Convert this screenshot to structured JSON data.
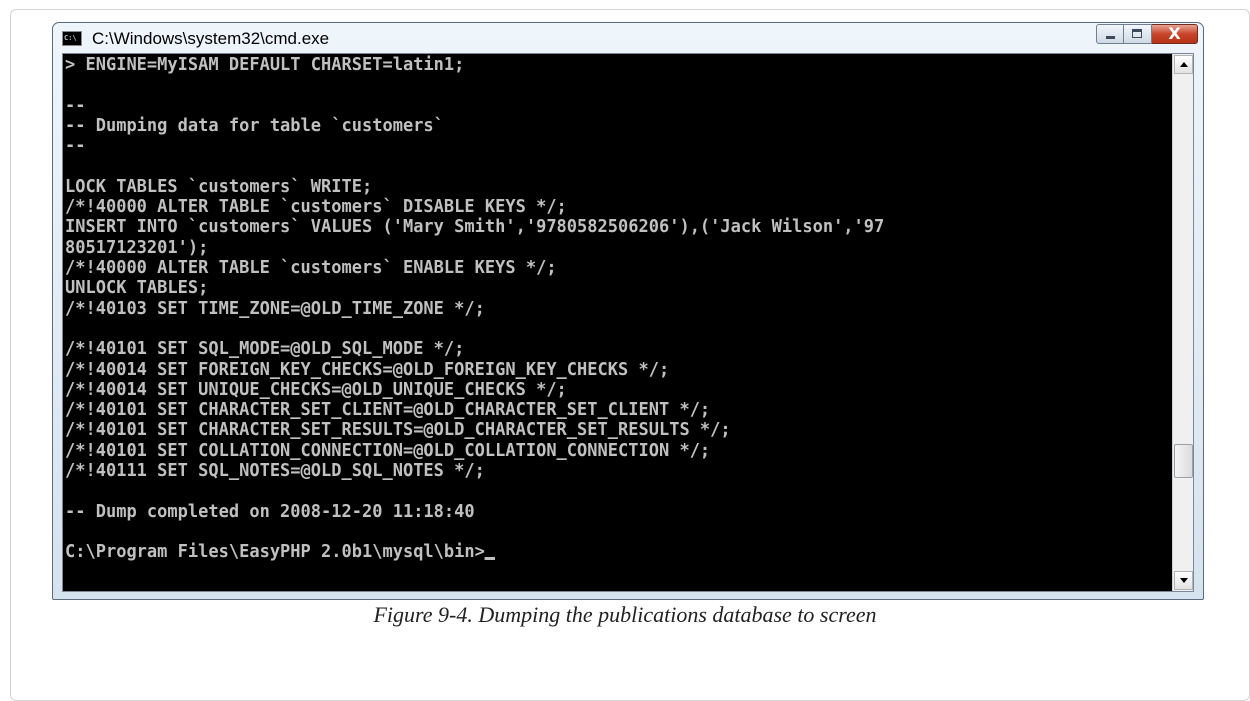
{
  "window": {
    "title": "C:\\Windows\\system32\\cmd.exe",
    "app_icon_text": "C:\\",
    "buttons": {
      "close": "X"
    }
  },
  "console": {
    "lines": [
      "> ENGINE=MyISAM DEFAULT CHARSET=latin1;",
      "",
      "--",
      "-- Dumping data for table `customers`",
      "--",
      "",
      "LOCK TABLES `customers` WRITE;",
      "/*!40000 ALTER TABLE `customers` DISABLE KEYS */;",
      "INSERT INTO `customers` VALUES ('Mary Smith','9780582506206'),('Jack Wilson','97",
      "80517123201');",
      "/*!40000 ALTER TABLE `customers` ENABLE KEYS */;",
      "UNLOCK TABLES;",
      "/*!40103 SET TIME_ZONE=@OLD_TIME_ZONE */;",
      "",
      "/*!40101 SET SQL_MODE=@OLD_SQL_MODE */;",
      "/*!40014 SET FOREIGN_KEY_CHECKS=@OLD_FOREIGN_KEY_CHECKS */;",
      "/*!40014 SET UNIQUE_CHECKS=@OLD_UNIQUE_CHECKS */;",
      "/*!40101 SET CHARACTER_SET_CLIENT=@OLD_CHARACTER_SET_CLIENT */;",
      "/*!40101 SET CHARACTER_SET_RESULTS=@OLD_CHARACTER_SET_RESULTS */;",
      "/*!40101 SET COLLATION_CONNECTION=@OLD_COLLATION_CONNECTION */;",
      "/*!40111 SET SQL_NOTES=@OLD_SQL_NOTES */;",
      "",
      "-- Dump completed on 2008-12-20 11:18:40",
      "",
      "C:\\Program Files\\EasyPHP 2.0b1\\mysql\\bin>"
    ]
  },
  "figure": {
    "caption": "Figure 9-4. Dumping the publications database to screen"
  },
  "colors": {
    "console_bg": "#000000",
    "console_text": "#c0c0c0",
    "close_button": "#c7452a"
  }
}
